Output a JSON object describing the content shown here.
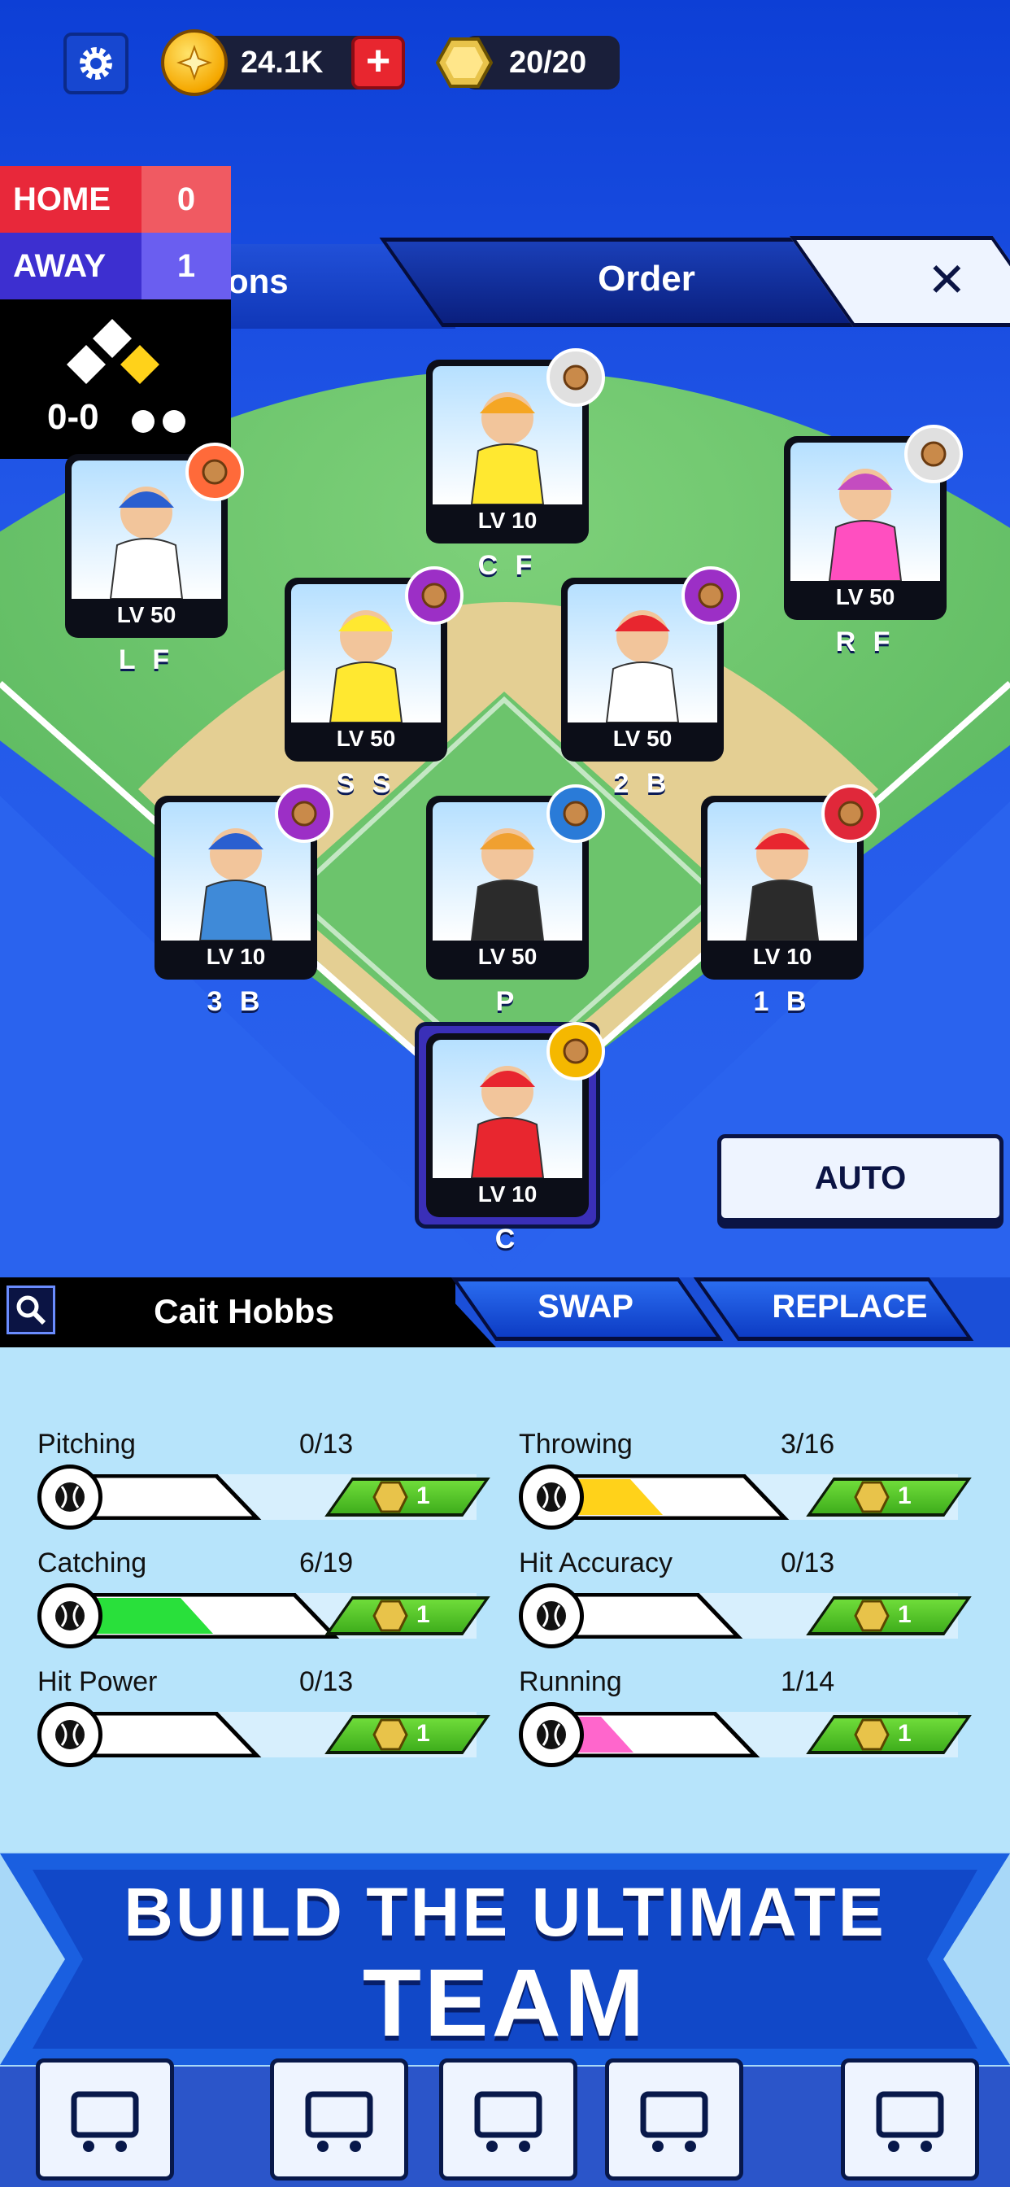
{
  "topbar": {
    "coins": "24.1K",
    "energy": "20/20"
  },
  "scoreboard": {
    "home_label": "HOME",
    "home_score": "0",
    "away_label": "AWAY",
    "away_score": "1",
    "count": "0-0"
  },
  "tabs": {
    "left_partial": "ons",
    "order": "Order",
    "close": "✕"
  },
  "players": [
    {
      "pos": "C F",
      "lv": "LV 10"
    },
    {
      "pos": "L F",
      "lv": "LV 50"
    },
    {
      "pos": "R F",
      "lv": "LV 50"
    },
    {
      "pos": "S S",
      "lv": "LV 50"
    },
    {
      "pos": "2 B",
      "lv": "LV 50"
    },
    {
      "pos": "3 B",
      "lv": "LV 10"
    },
    {
      "pos": "P",
      "lv": "LV 50"
    },
    {
      "pos": "1 B",
      "lv": "LV 10"
    },
    {
      "pos": "C",
      "lv": "LV 10"
    }
  ],
  "auto_label": "AUTO",
  "selected": {
    "name": "Cait Hobbs",
    "swap": "SWAP",
    "replace": "REPLACE"
  },
  "stats": [
    {
      "name": "Pitching",
      "value": "0/13",
      "cost": "1",
      "fill": 0,
      "fill_color": "#ffffff",
      "icon": "baseball-icon"
    },
    {
      "name": "Throwing",
      "value": "3/16",
      "cost": "1",
      "fill": 0.19,
      "fill_color": "#ffd21a",
      "icon": "throw-icon"
    },
    {
      "name": "Catching",
      "value": "6/19",
      "cost": "1",
      "fill": 0.32,
      "fill_color": "#29e03b",
      "icon": "glove-icon"
    },
    {
      "name": "Hit Accuracy",
      "value": "0/13",
      "cost": "1",
      "fill": 0,
      "fill_color": "#ffffff",
      "icon": "target-icon"
    },
    {
      "name": "Hit Power",
      "value": "0/13",
      "cost": "1",
      "fill": 0,
      "fill_color": "#ffffff",
      "icon": "muscle-icon"
    },
    {
      "name": "Running",
      "value": "1/14",
      "cost": "1",
      "fill": 0.07,
      "fill_color": "#ff66cc",
      "icon": "cleat-icon"
    }
  ],
  "banner": {
    "line1": "BUILD THE ULTIMATE",
    "line2": "TEAM"
  },
  "nav": [
    "shop-cart-icon",
    "roster-icon",
    "stadium-icon",
    "coach-icon",
    "stats-chart-icon"
  ]
}
